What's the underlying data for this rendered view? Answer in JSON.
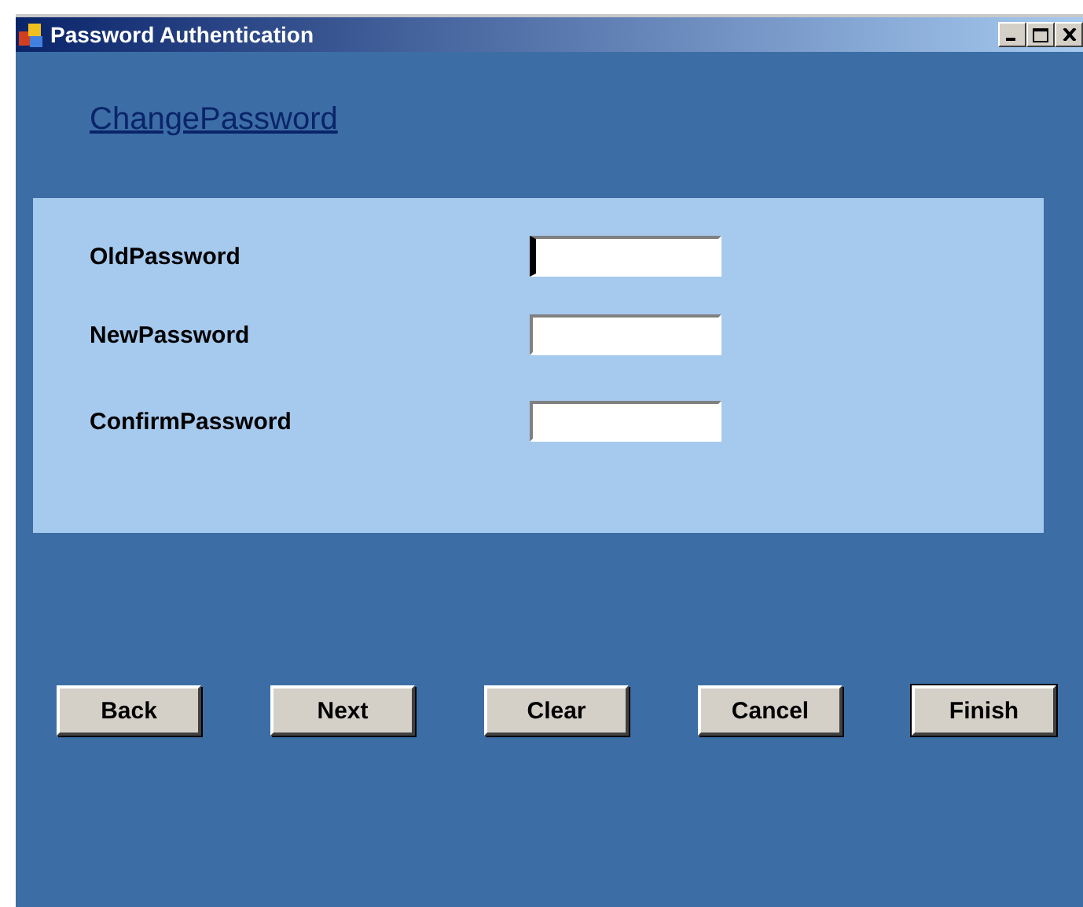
{
  "window": {
    "title": "Password Authentication"
  },
  "link": "ChangePassword",
  "fields": [
    {
      "label": "OldPassword",
      "focused": true
    },
    {
      "label": "NewPassword",
      "focused": false
    },
    {
      "label": "ConfirmPassword",
      "focused": false
    }
  ],
  "buttons": [
    {
      "label": "Back",
      "default": false
    },
    {
      "label": "Next",
      "default": false
    },
    {
      "label": "Clear",
      "default": false
    },
    {
      "label": "Cancel",
      "default": false
    },
    {
      "label": "Finish",
      "default": true
    }
  ]
}
